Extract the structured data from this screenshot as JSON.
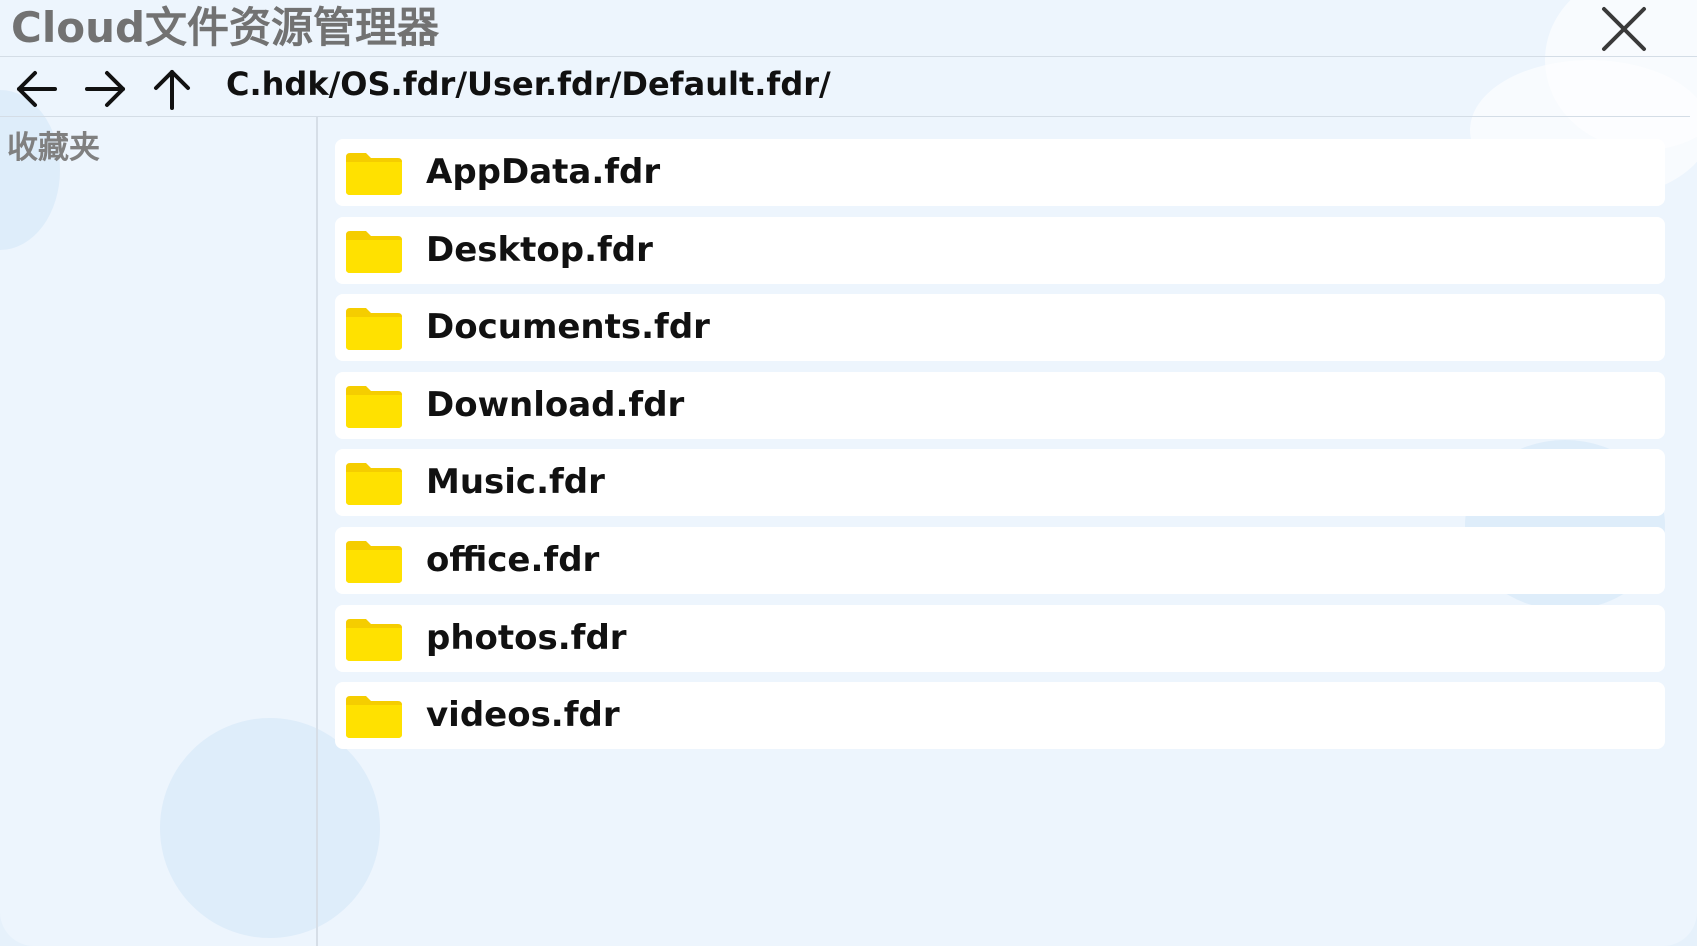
{
  "window": {
    "title": "Cloud文件资源管理器"
  },
  "toolbar": {
    "back_icon": "arrow-left-icon",
    "forward_icon": "arrow-right-icon",
    "up_icon": "arrow-up-icon",
    "close_icon": "close-icon",
    "path": "C.hdk/OS.fdr/User.fdr/Default.fdr/"
  },
  "sidebar": {
    "heading": "收藏夹"
  },
  "files": [
    {
      "name": "AppData.fdr",
      "icon": "folder-icon"
    },
    {
      "name": "Desktop.fdr",
      "icon": "folder-icon"
    },
    {
      "name": "Documents.fdr",
      "icon": "folder-icon"
    },
    {
      "name": "Download.fdr",
      "icon": "folder-icon"
    },
    {
      "name": "Music.fdr",
      "icon": "folder-icon"
    },
    {
      "name": "office.fdr",
      "icon": "folder-icon"
    },
    {
      "name": "photos.fdr",
      "icon": "folder-icon"
    },
    {
      "name": "videos.fdr",
      "icon": "folder-icon"
    }
  ],
  "colors": {
    "folder": "#ffe100",
    "folder_tab": "#f5cd00",
    "background": "#edf5fd",
    "row": "#ffffff",
    "title_text": "#727272"
  }
}
